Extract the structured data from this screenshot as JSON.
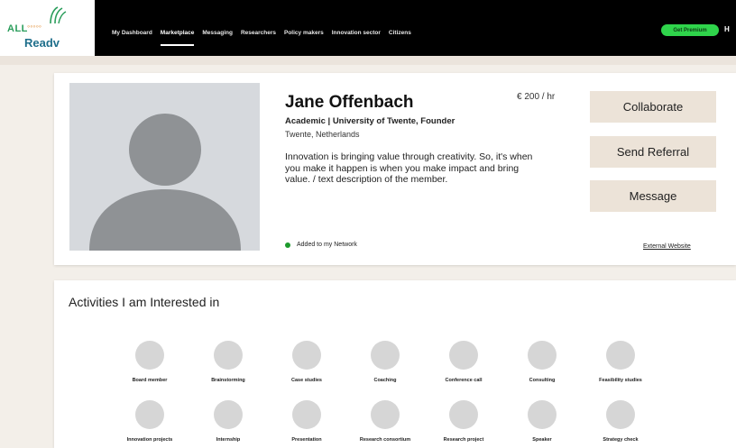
{
  "logo": {
    "line1": "ALL",
    "dots": "◦◦◦◦◦",
    "line2": "Readv"
  },
  "nav": {
    "items": [
      {
        "label": "My Dashboard",
        "active": false
      },
      {
        "label": "Marketplace",
        "active": true
      },
      {
        "label": "Messaging",
        "active": false
      },
      {
        "label": "Researchers",
        "active": false
      },
      {
        "label": "Policy makers",
        "active": false
      },
      {
        "label": "Innovation sector",
        "active": false
      },
      {
        "label": "Citizens",
        "active": false
      }
    ],
    "premium_label": "Get Premium",
    "more_label": "H"
  },
  "profile": {
    "name": "Jane Offenbach",
    "rate": "€ 200 / hr",
    "role": "Academic | University of Twente, Founder",
    "location": "Twente, Netherlands",
    "description": "Innovation is  bringing value through creativity. So, it's when you make it happen is when you make impact and bring value.  / text description of the member.",
    "network_status": "Added to my Network",
    "buttons": {
      "collaborate": "Collaborate",
      "referral": "Send Referral",
      "message": "Message"
    },
    "external_link": "External Website"
  },
  "activities": {
    "title": "Activities I am Interested in",
    "row1": [
      "Board member",
      "Brainstorming",
      "Case studies",
      "Coaching",
      "Conference call",
      "Consulting",
      "Feasibility studies"
    ],
    "row2": [
      "Innovation projects",
      "Internship",
      "Presentation",
      "Research consortium",
      "Research project",
      "Speaker",
      "Strategy check"
    ]
  },
  "colors": {
    "accent_green": "#2fd44b",
    "button_beige": "#ece3d8",
    "status_green": "#1c9a2c"
  }
}
